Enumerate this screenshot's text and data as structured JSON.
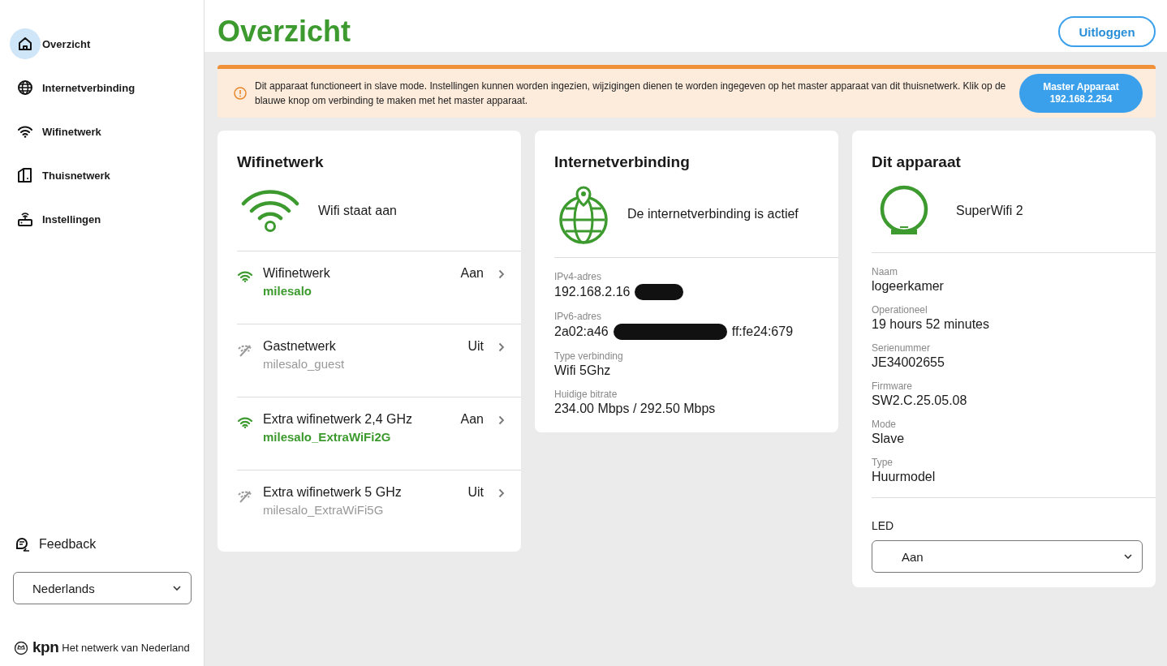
{
  "sidebar": {
    "items": [
      {
        "label": "Overzicht",
        "selected": true
      },
      {
        "label": "Internetverbinding",
        "selected": false
      },
      {
        "label": "Wifinetwerk",
        "selected": false
      },
      {
        "label": "Thuisnetwerk",
        "selected": false
      },
      {
        "label": "Instellingen",
        "selected": false
      }
    ],
    "feedback": "Feedback",
    "language": {
      "value": "Nederlands"
    },
    "brand": {
      "logo": "kpn",
      "tagline": "Het netwerk van Nederland"
    }
  },
  "header": {
    "title": "Overzicht",
    "logout": "Uitloggen"
  },
  "banner": {
    "message": "Dit apparaat functioneert in slave mode. Instellingen kunnen worden ingezien, wijzigingen dienen te worden ingegeven op het master apparaat van dit thuisnetwerk. Klik op de blauwe knop om verbinding te maken met het master apparaat.",
    "button_line_1": "Master Apparaat",
    "button_line_2": "192.168.2.254"
  },
  "wifi_card": {
    "title": "Wifinetwerk",
    "status": "Wifi staat aan",
    "networks": [
      {
        "name": "Wifinetwerk",
        "ssid": "milesalo",
        "on": true,
        "state": "Aan"
      },
      {
        "name": "Gastnetwerk",
        "ssid": "milesalo_guest",
        "on": false,
        "state": "Uit"
      },
      {
        "name": "Extra wifinetwerk 2,4 GHz",
        "ssid": "milesalo_ExtraWiFi2G",
        "on": true,
        "state": "Aan"
      },
      {
        "name": "Extra wifinetwerk 5 GHz",
        "ssid": "milesalo_ExtraWiFi5G",
        "on": false,
        "state": "Uit"
      }
    ]
  },
  "internet_card": {
    "title": "Internetverbinding",
    "status": "De internetverbinding is actief",
    "fields": [
      {
        "kind": "redacted",
        "label": "IPv4-adres",
        "parts": [
          "192.168.2.16"
        ]
      },
      {
        "kind": "redacted",
        "label": "IPv6-adres",
        "parts": [
          "2a02:a46",
          "ff:fe24:679"
        ]
      },
      {
        "kind": "plain",
        "label": "Type verbinding",
        "value": "Wifi 5Ghz"
      },
      {
        "kind": "plain",
        "label": "Huidige bitrate",
        "value": "234.00 Mbps / 292.50 Mbps"
      }
    ]
  },
  "device_card": {
    "title": "Dit apparaat",
    "model": "SuperWifi 2",
    "fields": [
      {
        "label": "Naam",
        "value": "logeerkamer"
      },
      {
        "label": "Operationeel",
        "value": "19 hours 52 minutes"
      },
      {
        "label": "Serienummer",
        "value": "JE34002655"
      },
      {
        "label": "Firmware",
        "value": "SW2.C.25.05.08"
      },
      {
        "label": "Mode",
        "value": "Slave"
      },
      {
        "label": "Type",
        "value": "Huurmodel"
      }
    ],
    "led": {
      "label": "LED",
      "value": "Aan"
    }
  }
}
